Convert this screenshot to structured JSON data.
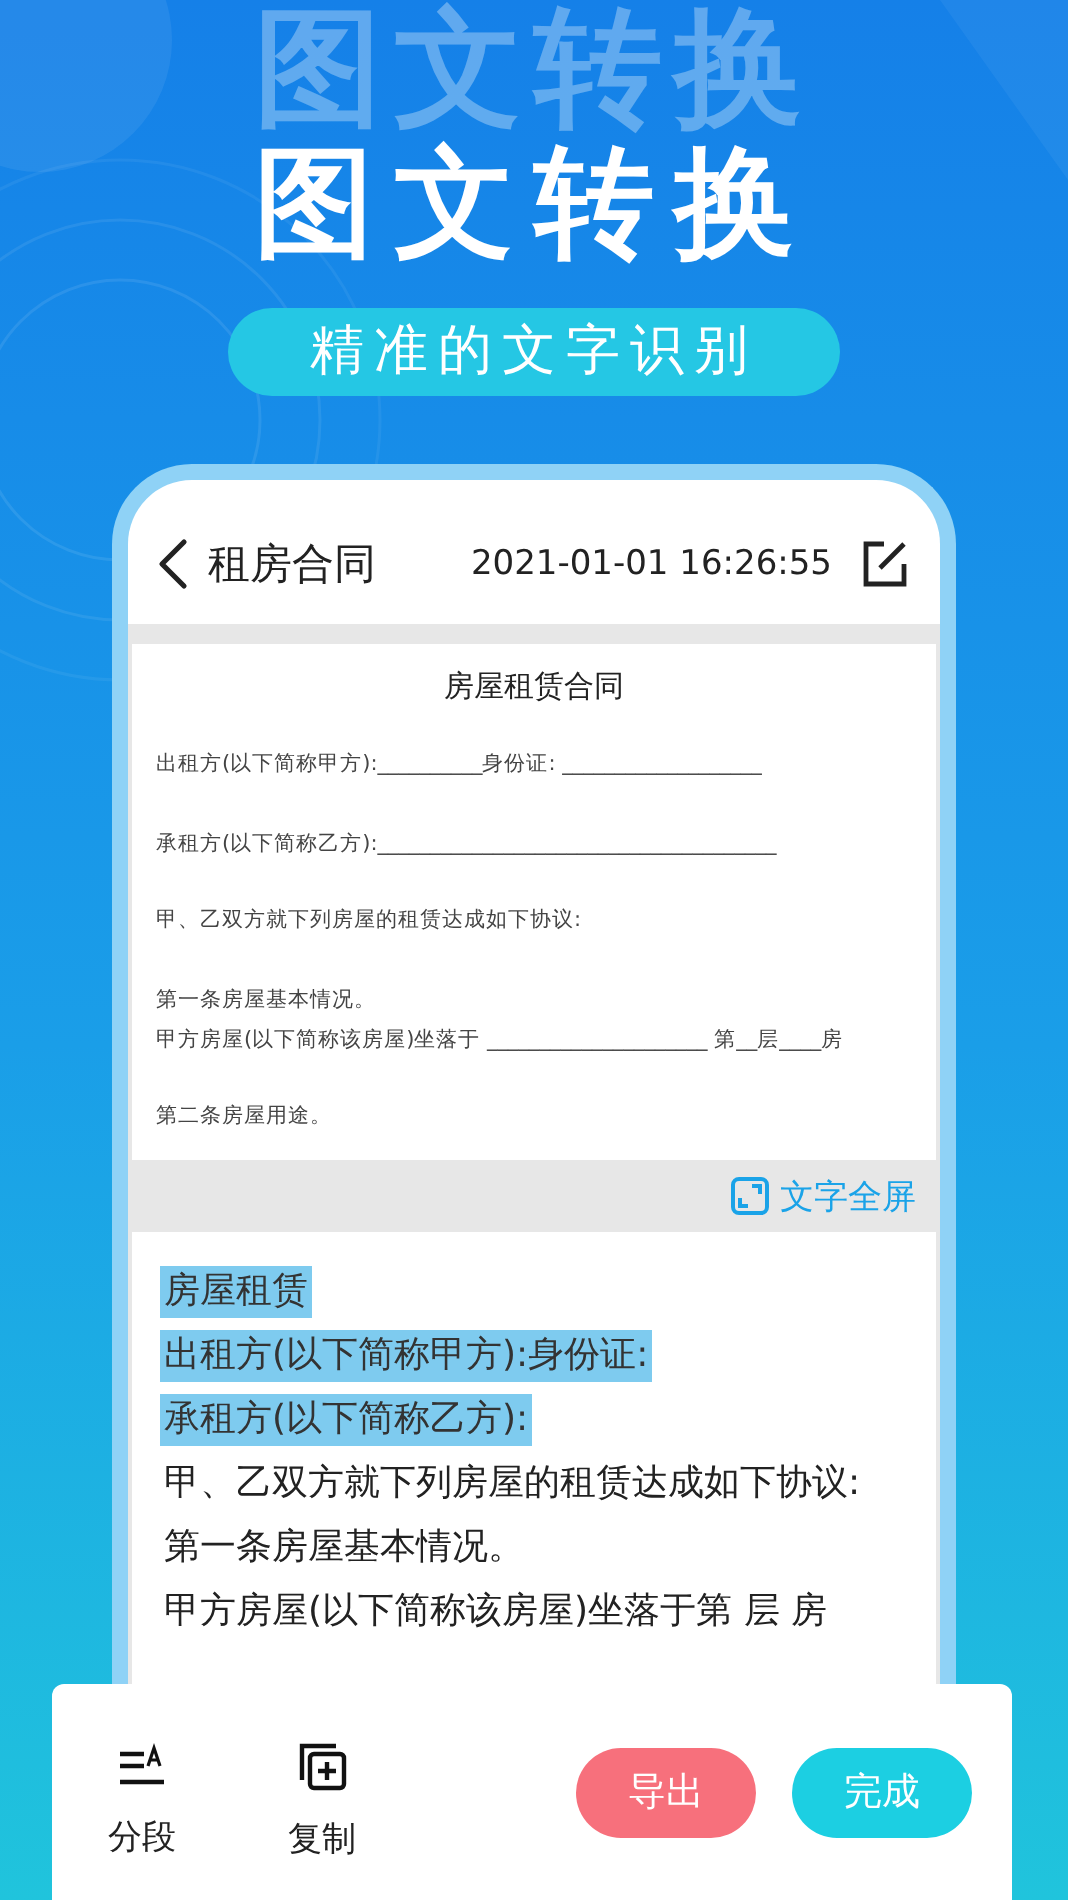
{
  "background_title": "图文转换",
  "title": "图文转换",
  "subtitle": "精准的文字识别",
  "header": {
    "title": "租房合同",
    "datetime": "2021-01-01 16:26:55"
  },
  "document": {
    "title": "房屋租赁合同",
    "lines": [
      "出租方(以下简称甲方):__________身份证: ___________________",
      "承租方(以下简称乙方):______________________________________",
      "甲、乙双方就下列房屋的租赁达成如下协议:",
      "第一条房屋基本情况。",
      "甲方房屋(以下简称该房屋)坐落于 _____________________ 第__层____房",
      "第二条房屋用途。"
    ]
  },
  "fullscreen_link": "文字全屏",
  "recognized_lines": [
    {
      "text": "房屋租赁",
      "selected": true
    },
    {
      "text": "出租方(以下简称甲方):身份证:",
      "selected": true
    },
    {
      "text": "承租方(以下简称乙方):",
      "selected": true
    },
    {
      "text": "甲、乙双方就下列房屋的租赁达成如下协议:",
      "selected": false
    },
    {
      "text": "第一条房屋基本情况。",
      "selected": false
    },
    {
      "text": "甲方房屋(以下简称该房屋)坐落于第 层 房",
      "selected": false
    }
  ],
  "toolbar": {
    "tools": [
      {
        "kind": "paragraph",
        "label": "分段"
      },
      {
        "kind": "copy",
        "label": "复制"
      }
    ],
    "buttons": [
      {
        "label": "导出",
        "color": "#f7707c"
      },
      {
        "label": "完成",
        "color": "#1ccfe2"
      }
    ]
  }
}
